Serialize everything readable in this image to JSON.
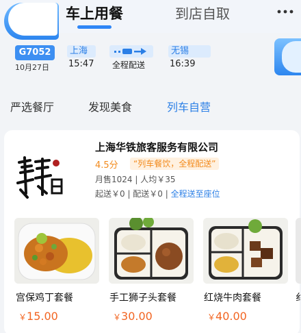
{
  "nav": {
    "tab_active": "车上用餐",
    "tab_inactive": "到店自取"
  },
  "train": {
    "number": "G7052",
    "date": "10月27日",
    "from_station": "上海",
    "from_time": "15:47",
    "to_station": "无锡",
    "to_time": "16:39",
    "middle_label": "全程配送"
  },
  "categories": [
    "严选餐厅",
    "发现美食",
    "列车自营"
  ],
  "shop": {
    "name": "上海华铁旅客服务有限公司",
    "score": "4.5分",
    "tag": "“列车餐饮，全程配送”",
    "stats": "月售1024 | 人均￥35",
    "delivery_prefix": "起送￥0 | 配送￥0 | ",
    "delivery_link": "全程送至座位"
  },
  "dishes": [
    {
      "name": "宫保鸡丁套餐",
      "price": "15.00"
    },
    {
      "name": "手工狮子头套餐",
      "price": "30.00"
    },
    {
      "name": "红烧牛肉套餐",
      "price": "40.00"
    }
  ],
  "edge_dish_fragment": "纟",
  "currency_symbol": "￥",
  "colors": {
    "accent_blue": "#2b7fe6",
    "price_orange": "#f26522",
    "score_orange": "#f28a1c"
  }
}
